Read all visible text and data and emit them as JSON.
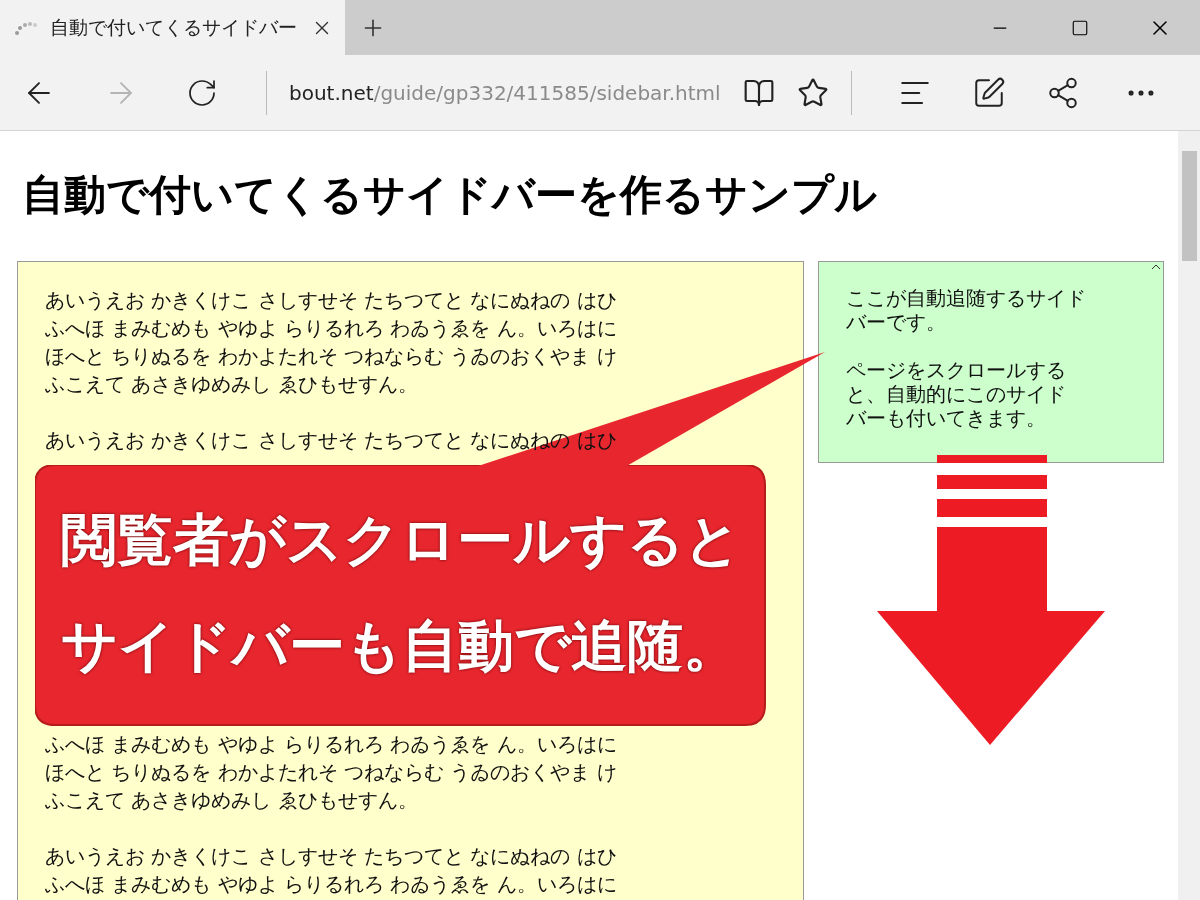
{
  "browser": {
    "tab": {
      "title": "自動で付いてくるサイドバー"
    },
    "forward_disabled": true,
    "address": {
      "host": "bout.net",
      "path": "/guide/gp332/411585/sidebar.html"
    }
  },
  "page": {
    "title": "自動で付いてくるサイドバーを作るサンプル",
    "main_column": {
      "blocks": [
        {
          "kind": "text",
          "lines": [
            "あいうえお かきくけこ さしすせそ たちつてと なにぬねの はひ",
            "ふへほ まみむめも やゆよ らりるれろ わゐうゑを ん。いろはに",
            "ほへと ちりぬるを わかよたれそ つねならむ うゐのおくやま け",
            "ふこえて あさきゆめみし ゑひもせすん。"
          ]
        },
        {
          "kind": "text",
          "lines": [
            "あいうえお かきくけこ さしすせそ たちつてと なにぬねの はひ"
          ]
        },
        {
          "kind": "covered"
        },
        {
          "kind": "text",
          "lines": [
            "ふへほ まみむめも やゆよ らりるれろ わゐうゑを ん。いろはに",
            "ほへと ちりぬるを わかよたれそ つねならむ うゐのおくやま け",
            "ふこえて あさきゆめみし ゑひもせすん。"
          ]
        },
        {
          "kind": "text",
          "lines": [
            "あいうえお かきくけこ さしすせそ たちつてと なにぬねの はひ",
            "ふへほ まみむめも やゆよ らりるれろ わゐうゑを ん。いろはに"
          ]
        }
      ]
    },
    "sidebar": {
      "paragraphs": [
        {
          "lines": [
            "ここが自動追随するサイド",
            "バーです。"
          ]
        },
        {
          "lines": [
            "ページをスクロールする",
            "と、自動的にこのサイド",
            "バーも付いてきます。"
          ]
        }
      ]
    }
  },
  "callout": {
    "lines": [
      "閲覧者がスクロールすると",
      "サイドバーも自動で追随。"
    ]
  }
}
